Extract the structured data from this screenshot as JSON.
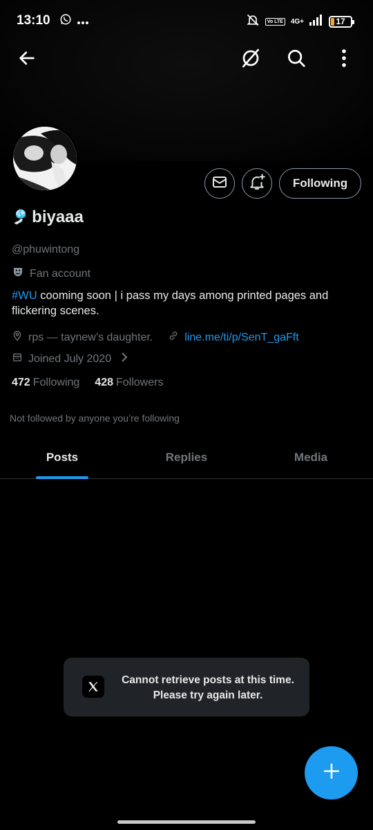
{
  "status_bar": {
    "time": "13:10",
    "network": "4G+",
    "volte": "Vo LTE",
    "battery": "17",
    "battery_level": 0.17,
    "battery_color": "#f5a623"
  },
  "header": {
    "back_icon": "arrow-left-icon",
    "icons": [
      "no-data-saver-icon",
      "search-icon",
      "more-vertical-icon"
    ]
  },
  "profile": {
    "display_name": "biyaaa",
    "name_emoji": "🎐",
    "handle": "@phuwintong",
    "category": "Fan account",
    "category_icon": "theater-masks-icon",
    "bio_hashtag": "#WU",
    "bio_text": " cooming soon | i pass my days among printed pages and flickering scenes.",
    "location": "rps — taynew’s daughter.",
    "link": "line.me/ti/p/SenT_gaFft",
    "joined": "Joined July 2020",
    "following_count": "472",
    "following_label": "Following",
    "followers_count": "428",
    "followers_label": "Followers",
    "not_followed": "Not followed by anyone you’re following"
  },
  "actions": {
    "message_icon": "mail-icon",
    "notify_icon": "bell-plus-icon",
    "following_label": "Following"
  },
  "tabs": [
    {
      "label": "Posts",
      "active": true
    },
    {
      "label": "Replies",
      "active": false
    },
    {
      "label": "Media",
      "active": false
    }
  ],
  "toast": {
    "icon": "x-logo-icon",
    "message": "Cannot retrieve posts at this time. Please try again later."
  },
  "fab": {
    "icon": "plus-icon"
  },
  "colors": {
    "accent": "#1d9bf0",
    "background": "#000000",
    "text_primary": "#e7e9ea",
    "text_secondary": "#71767b"
  }
}
